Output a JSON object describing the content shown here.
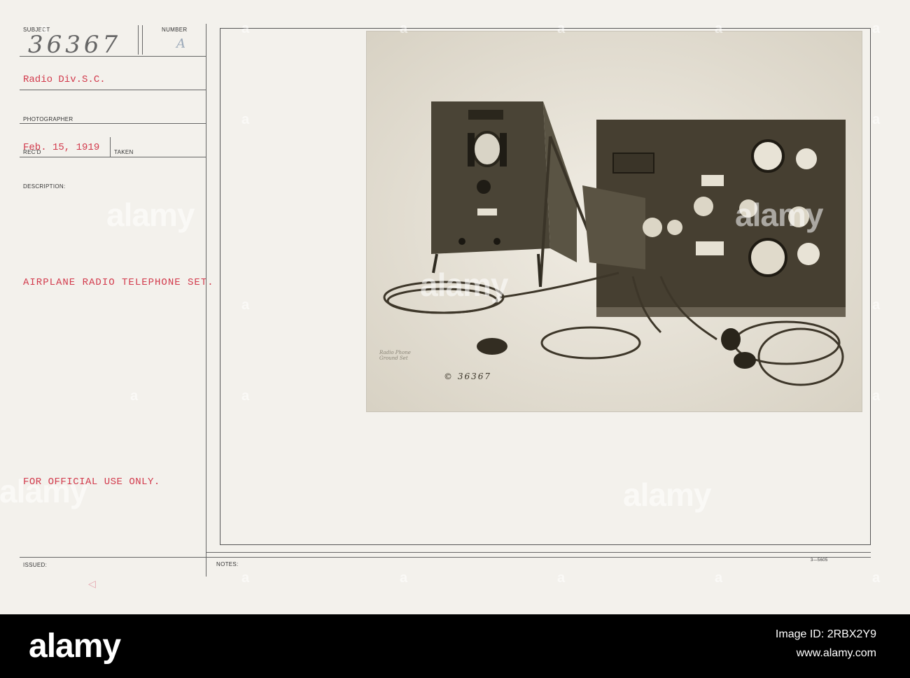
{
  "card": {
    "subject_label": "SUBJECT",
    "number_label": "NUMBER",
    "subject_number": "36367",
    "number_value": "A",
    "division": "Radio Div.S.C.",
    "photographer_label": "PHOTOGRAPHER",
    "date": "Feb. 15, 1919",
    "recd_label": "REC'D",
    "taken_label": "TAKEN",
    "description_label": "DESCRIPTION:",
    "description": "AIRPLANE RADIO TELEPHONE SET.",
    "official": "FOR OFFICIAL USE ONLY.",
    "issued_label": "ISSUED:",
    "notes_label": "NOTES:",
    "form_number": "3—5605",
    "arrow_mark": "◁",
    "photo_number": "© 36367",
    "photo_caption": "Radio Phone Ground Set"
  },
  "watermark": {
    "text": "alamy",
    "letter": "a"
  },
  "footer": {
    "logo": "alamy",
    "image_id_label": "Image ID: 2RBX2Y9",
    "url": "www.alamy.com"
  },
  "colors": {
    "typed_red": "#d23a4c",
    "card_bg": "#f3f1ec",
    "footer_bg": "#000000"
  }
}
